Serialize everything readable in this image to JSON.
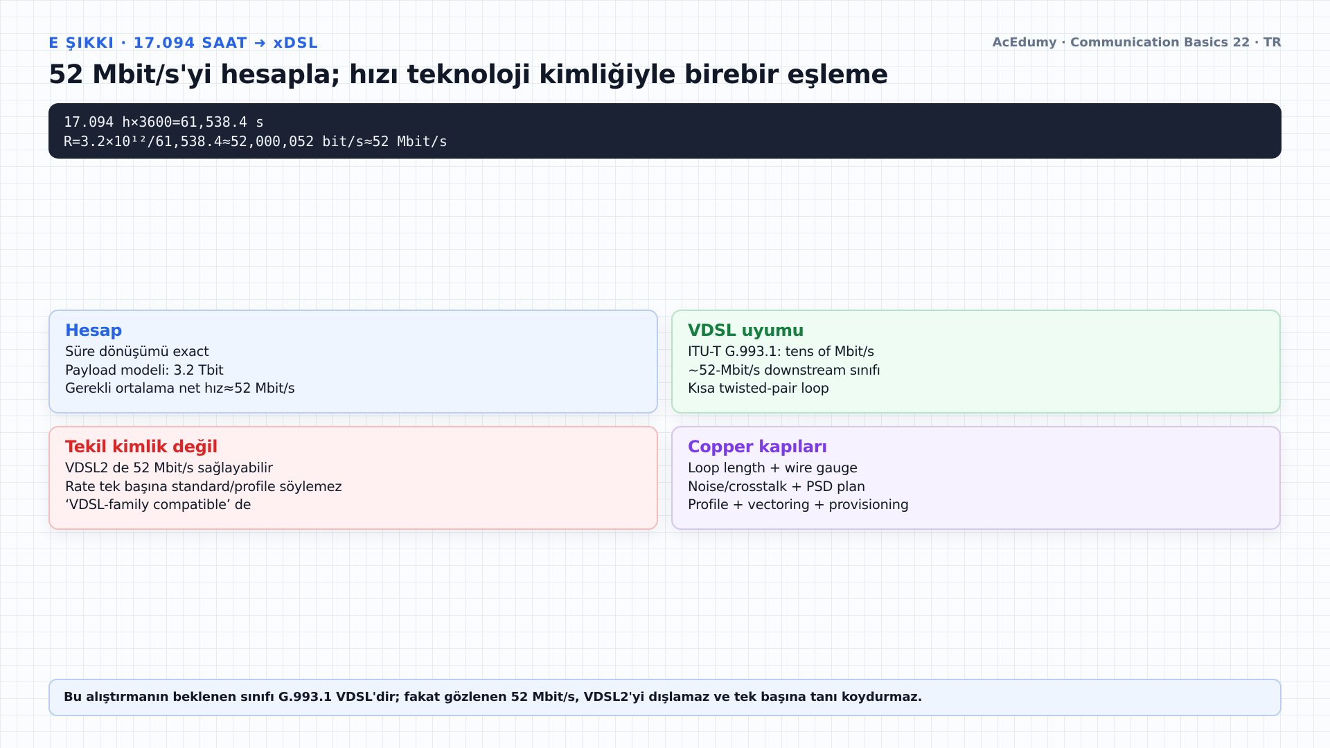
{
  "header": {
    "kicker": "E ŞIKKI · 17.094 SAAT ➜ xDSL",
    "brand": "AcEdumy · Communication Basics 22 · TR",
    "title": "52 Mbit/s'yi hesapla; hızı teknoloji kimliğiyle birebir eşleme"
  },
  "calculation": {
    "lines": [
      "17.094 h×3600=61,538.4 s",
      "R=3.2×10¹²/61,538.4≈52,000,052 bit/s≈52 Mbit/s"
    ]
  },
  "cards": [
    {
      "title": "Hesap",
      "accent": "#2563eb",
      "items": [
        "Süre dönüşümü exact",
        "Payload modeli: 3.2 Tbit",
        "Gerekli ortalama net hız≈52 Mbit/s"
      ]
    },
    {
      "title": "VDSL uyumu",
      "accent": "#15803d",
      "items": [
        "ITU-T G.993.1: tens of Mbit/s",
        "~52-Mbit/s downstream sınıfı",
        "Kısa twisted-pair loop"
      ]
    },
    {
      "title": "Tekil kimlik değil",
      "accent": "#dc2626",
      "items": [
        "VDSL2 de 52 Mbit/s sağlayabilir",
        "Rate tek başına standard/profile söylemez",
        "‘VDSL-family compatible’ de"
      ]
    },
    {
      "title": "Copper kapıları",
      "accent": "#7c3aed",
      "items": [
        "Loop length + wire gauge",
        "Noise/crosstalk + PSD plan",
        "Profile + vectoring + provisioning"
      ]
    }
  ],
  "footer": {
    "note": "Bu alıştırmanın beklenen sınıfı G.993.1 VDSL'dir; fakat gözlenen 52 Mbit/s, VDSL2'yi dışlamaz ve tek başına tanı koydurmaz."
  }
}
